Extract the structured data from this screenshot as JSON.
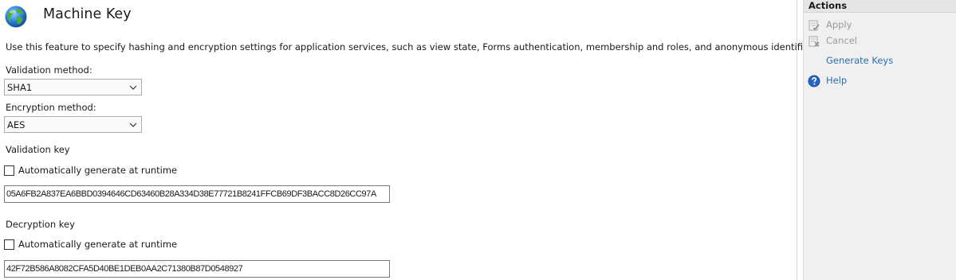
{
  "header": {
    "title": "Machine Key",
    "icon": "globe-icon"
  },
  "description": "Use this feature to specify hashing and encryption settings for application services, such as view state, Forms authentication, membership and roles, and anonymous identification.",
  "validation_method": {
    "label": "Validation method:",
    "value": "SHA1"
  },
  "encryption_method": {
    "label": "Encryption method:",
    "value": "AES"
  },
  "validation_key": {
    "label": "Validation key",
    "auto_generate_label": "Automatically generate at runtime",
    "auto_generate_checked": false,
    "value": "05A6FB2A837EA6BBD0394646CD63460B28A334D38E77721B8241FFCB69DF3BACC8D26CC97A"
  },
  "decryption_key": {
    "label": "Decryption key",
    "auto_generate_label": "Automatically generate at runtime",
    "auto_generate_checked": false,
    "value": "42F72B586A8082CFA5D40BE1DEB0AA2C71380B87D0548927"
  },
  "actions": {
    "title": "Actions",
    "items": [
      {
        "label": "Apply",
        "icon": "apply-icon",
        "enabled": false
      },
      {
        "label": "Cancel",
        "icon": "cancel-icon",
        "enabled": false
      },
      {
        "label": "Generate Keys",
        "icon": "",
        "enabled": true
      },
      {
        "label": "Help",
        "icon": "help-icon",
        "enabled": true
      }
    ]
  },
  "colors": {
    "link": "#2a6fb8",
    "disabled": "#9a9a9a",
    "actions_pane_bg": "#f0f0f0"
  }
}
